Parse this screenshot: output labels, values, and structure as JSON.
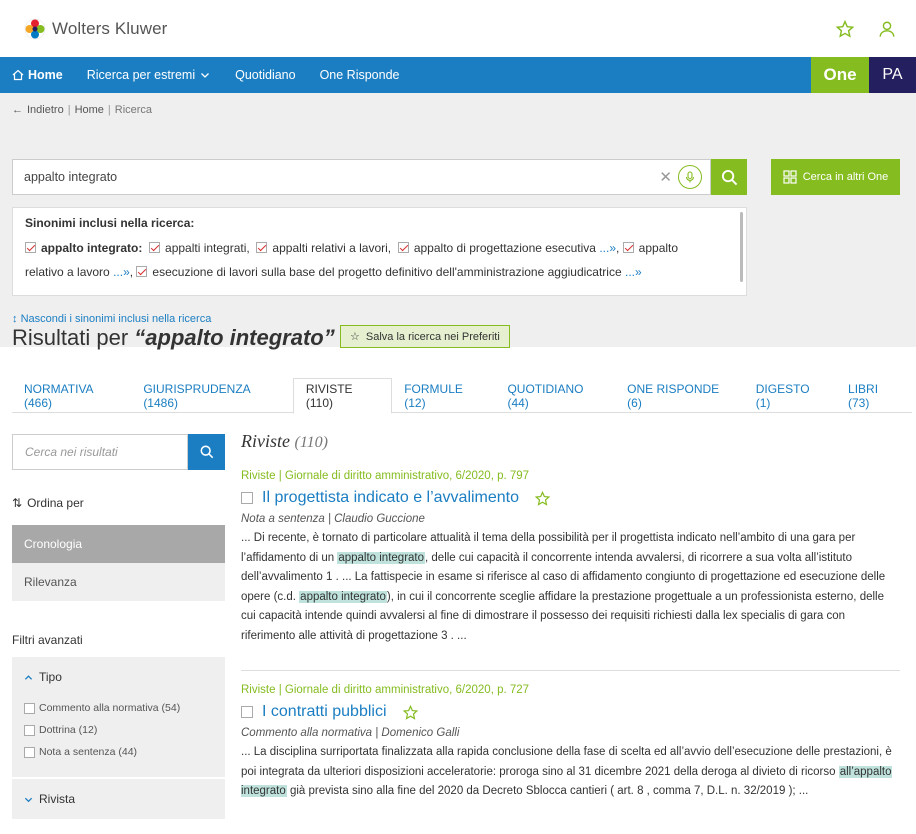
{
  "header": {
    "brand": "Wolters Kluwer"
  },
  "nav": {
    "items": [
      "Home",
      "Ricerca per estremi",
      "Quotidiano",
      "One Risponde"
    ],
    "one": "One",
    "pa": "PA"
  },
  "breadcrumb": {
    "back": "Indietro",
    "home": "Home",
    "current": "Ricerca"
  },
  "search": {
    "value": "appalto integrato",
    "other_button": "Cerca in altri One"
  },
  "synonyms": {
    "title": "Sinonimi inclusi nella ricerca:",
    "lead": "appalto integrato:",
    "items": [
      "appalti integrati,",
      "appalti relativi a lavori,",
      "appalto di progettazione esecutiva",
      "appalto relativo a lavoro",
      "esecuzione di lavori sulla base del progetto definitivo dell'amministrazione aggiudicatrice"
    ],
    "more": "...»",
    "hide_link": "Nascondi i sinonimi inclusi nella ricerca"
  },
  "results_header": {
    "prefix": "Risultati per",
    "query": "“appalto integrato”",
    "save_label": "Salva la ricerca nei Preferiti"
  },
  "tabs": [
    "NORMATIVA (466)",
    "GIURISPRUDENZA (1486)",
    "RIVISTE (110)",
    "FORMULE (12)",
    "QUOTIDIANO (44)",
    "ONE RISPONDE (6)",
    "DIGESTO (1)",
    "LIBRI (73)"
  ],
  "sidebar": {
    "search_placeholder": "Cerca nei risultati",
    "sort_label": "Ordina per",
    "sort_options": [
      "Cronologia",
      "Rilevanza"
    ],
    "filters_title": "Filtri avanzati",
    "tipo": {
      "label": "Tipo",
      "items": [
        "Commento alla normativa (54)",
        "Dottrina (12)",
        "Nota a sentenza (44)"
      ]
    },
    "rivista": {
      "label": "Rivista"
    }
  },
  "results": {
    "heading": "Riviste",
    "count": "(110)",
    "items": [
      {
        "source": "Riviste | Giornale di diritto amministrativo, 6/2020, p. 797",
        "title": "Il progettista indicato e l’avvalimento",
        "meta": "Nota a sentenza | Claudio Guccione",
        "t1": "... Di recente, è tornato di particolare attualità il tema della possibilità per il progettista indicato nell’ambito di una gara per l’affidamento di un ",
        "h1": "appalto integrato",
        "t2": ", delle cui capacità il concorrente intenda avvalersi, di ricorrere a sua volta all’istituto dell’avvalimento 1 . ... La fattispecie in esame si riferisce al caso di affidamento congiunto di progettazione ed esecuzione delle opere (c.d. ",
        "h2": "appalto integrato",
        "t3": "), in cui il concorrente sceglie affidare la prestazione progettuale a un professionista esterno, delle cui capacità intende quindi avvalersi al fine di dimostrare il possesso dei requisiti richiesti dalla lex specialis di gara con riferimento alle attività di progettazione 3 . ..."
      },
      {
        "source": "Riviste | Giornale di diritto amministrativo, 6/2020, p. 727",
        "title": "I contratti pubblici",
        "meta": "Commento alla normativa | Domenico Galli",
        "t1": "... La disciplina surriportata finalizzata alla rapida conclusione della fase di scelta ed all’avvio dell’esecuzione delle prestazioni, è poi integrata da ulteriori disposizioni acceleratorie: proroga sino al 31 dicembre 2021 della deroga al divieto di ricorso ",
        "h1": "all’appalto integrato",
        "t2": " già prevista sino alla fine del 2020 da Decreto Sblocca cantieri ( art. 8 , comma 7, D.L. n. 32/2019 ); ..."
      }
    ]
  },
  "colors": {
    "brand_blue": "#1b7ec2",
    "brand_green": "#85bc20",
    "pa_navy": "#241f5e"
  }
}
